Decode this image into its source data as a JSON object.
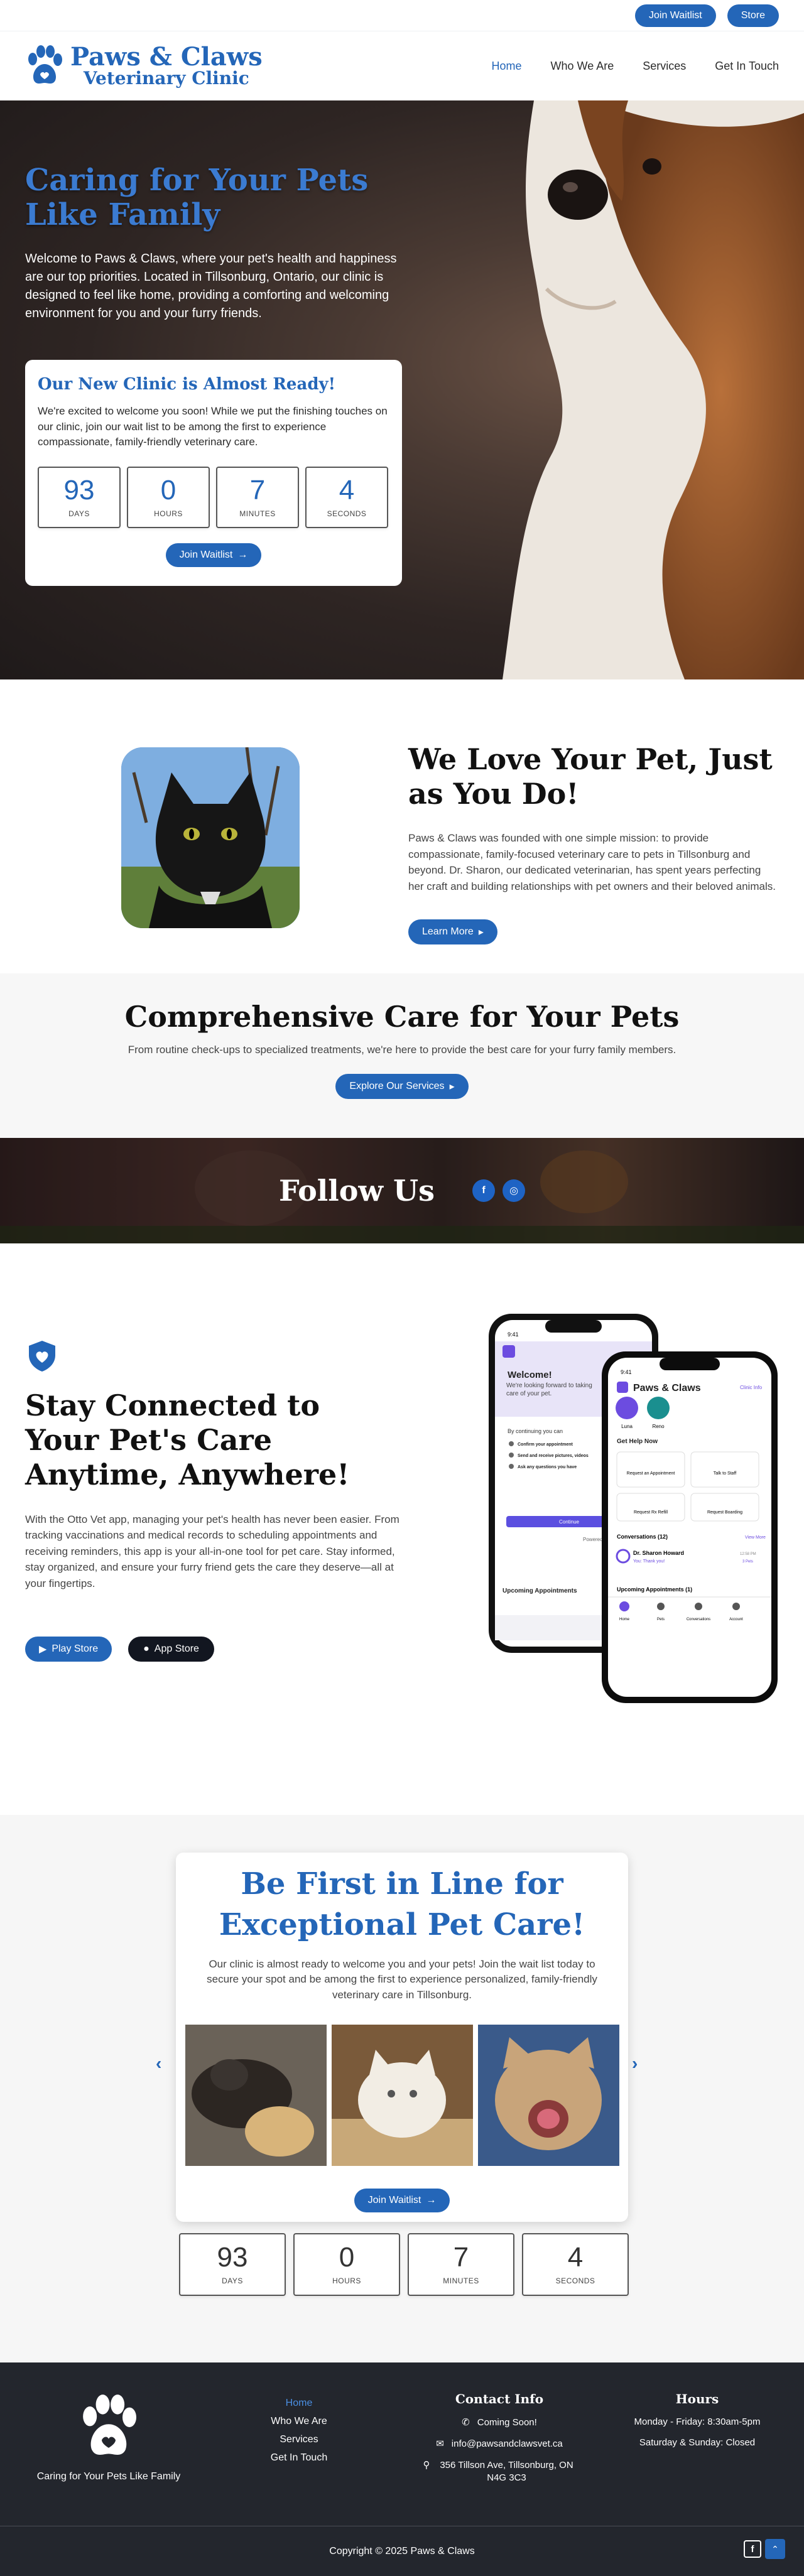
{
  "topbar": {
    "waitlist_label": "Join Waitlist",
    "store_label": "Store"
  },
  "brand": {
    "line1": "Paws & Claws",
    "line2": "Veterinary Clinic"
  },
  "nav": {
    "items": [
      {
        "label": "Home",
        "active": true
      },
      {
        "label": "Who We Are",
        "active": false
      },
      {
        "label": "Services",
        "active": false
      },
      {
        "label": "Get In Touch",
        "active": false
      }
    ]
  },
  "hero": {
    "title": "Caring for Your Pets Like Family",
    "body": "Welcome to Paws & Claws, where your pet's health and happiness are our top priorities. Located in Tillsonburg, Ontario, our clinic is designed to feel like home, providing a comforting and welcoming environment for you and your furry friends.",
    "card_title": "Our New Clinic is Almost Ready!",
    "card_body": "We're excited to welcome you soon! While we put the finishing touches on our clinic, join our wait list to be among the first to experience compassionate, family-friendly veterinary care.",
    "countdown": [
      {
        "value": "93",
        "label": "DAYS"
      },
      {
        "value": "0",
        "label": "HOURS"
      },
      {
        "value": "7",
        "label": "MINUTES"
      },
      {
        "value": "4",
        "label": "SECONDS"
      }
    ],
    "button_label": "Join Waitlist"
  },
  "about": {
    "title": "We Love Your Pet, Just as You Do!",
    "body": "Paws & Claws was founded with one simple mission: to provide compassionate, family-focused veterinary care to pets in Tillsonburg and beyond. Dr. Sharon, our dedicated veterinarian, has spent years perfecting her craft and building relationships with pet owners and their beloved animals.",
    "button_label": "Learn More"
  },
  "services": {
    "title": "Comprehensive Care for Your Pets",
    "body": "From routine check-ups to specialized treatments, we're here to provide the best care for your furry family members.",
    "button_label": "Explore Our Services"
  },
  "follow": {
    "title": "Follow Us"
  },
  "app": {
    "title": "Stay Connected to Your Pet's Care Anytime, Anywhere!",
    "body": "With the Otto Vet app, managing your pet's health has never been easier. From tracking vaccinations and medical records to scheduling appointments and receiving reminders, this app is your all-in-one tool for pet care. Stay informed, stay organized, and ensure your furry friend gets the care they deserve—all at your fingertips.",
    "play_label": "Play Store",
    "apple_label": "App Store",
    "phone_back": {
      "time": "9:41",
      "title": "Welcome!",
      "subtitle": "We're looking forward to taking care of your pet.",
      "continue_text": "By continuing you can",
      "items": [
        "Confirm your appointment",
        "Send and receive pictures, videos",
        "Ask any questions you have"
      ],
      "continue_button": "Continue",
      "powered": "Powered by Ot",
      "upcoming": "Upcoming Appointments"
    },
    "phone_front": {
      "time": "9:41",
      "brand": "Paws & Claws",
      "clinic_info": "Clinic Info",
      "pets": [
        "Luna",
        "Reno"
      ],
      "help_title": "Get Help Now",
      "actions": [
        "Request an Appointment",
        "Talk to Staff",
        "Request Rx Refill",
        "Request Boarding"
      ],
      "conversations": "Conversations (12)",
      "view_more": "View More",
      "doctor": "Dr. Sharon Howard",
      "message": "You: Thank you!",
      "msg_time": "12:58 PM",
      "msg_tag": "3 Pets",
      "upcoming": "Upcoming Appointments (1)",
      "tabs": [
        "Home",
        "Pets",
        "Conversations",
        "Account"
      ]
    }
  },
  "waitlist": {
    "title": "Be First in Line for Exceptional Pet Care!",
    "body": "Our clinic is almost ready to welcome you and your pets! Join the wait list today to secure your spot and be among the first to experience personalized, family-friendly veterinary care in Tillsonburg.",
    "button_label": "Join Waitlist",
    "countdown": [
      {
        "value": "93",
        "label": "DAYS"
      },
      {
        "value": "0",
        "label": "HOURS"
      },
      {
        "value": "7",
        "label": "MINUTES"
      },
      {
        "value": "4",
        "label": "SECONDS"
      }
    ]
  },
  "footer": {
    "tagline": "Caring for Your Pets Like Family",
    "links": [
      "Home",
      "Who We Are",
      "Services",
      "Get In Touch"
    ],
    "contact_title": "Contact Info",
    "phone": "Coming Soon!",
    "email": "info@pawsandclawsvet.ca",
    "address": "356 Tillson Ave, Tillsonburg, ON N4G 3C3",
    "hours_title": "Hours",
    "hours": [
      "Monday - Friday: 8:30am-5pm",
      "Saturday & Sunday: Closed"
    ],
    "copyright": "Copyright © 2025 Paws & Claws"
  },
  "colors": {
    "brand_blue": "#2466b8",
    "dark": "#23262d"
  },
  "icons": [
    "paw-logo-icon",
    "arrow-right-icon",
    "caret-right-icon",
    "facebook-icon",
    "instagram-icon",
    "heart-shield-icon",
    "play-icon",
    "apple-icon",
    "phone-icon",
    "mail-icon",
    "map-pin-icon",
    "chevron-left-icon",
    "chevron-right-icon",
    "chevron-up-icon"
  ]
}
